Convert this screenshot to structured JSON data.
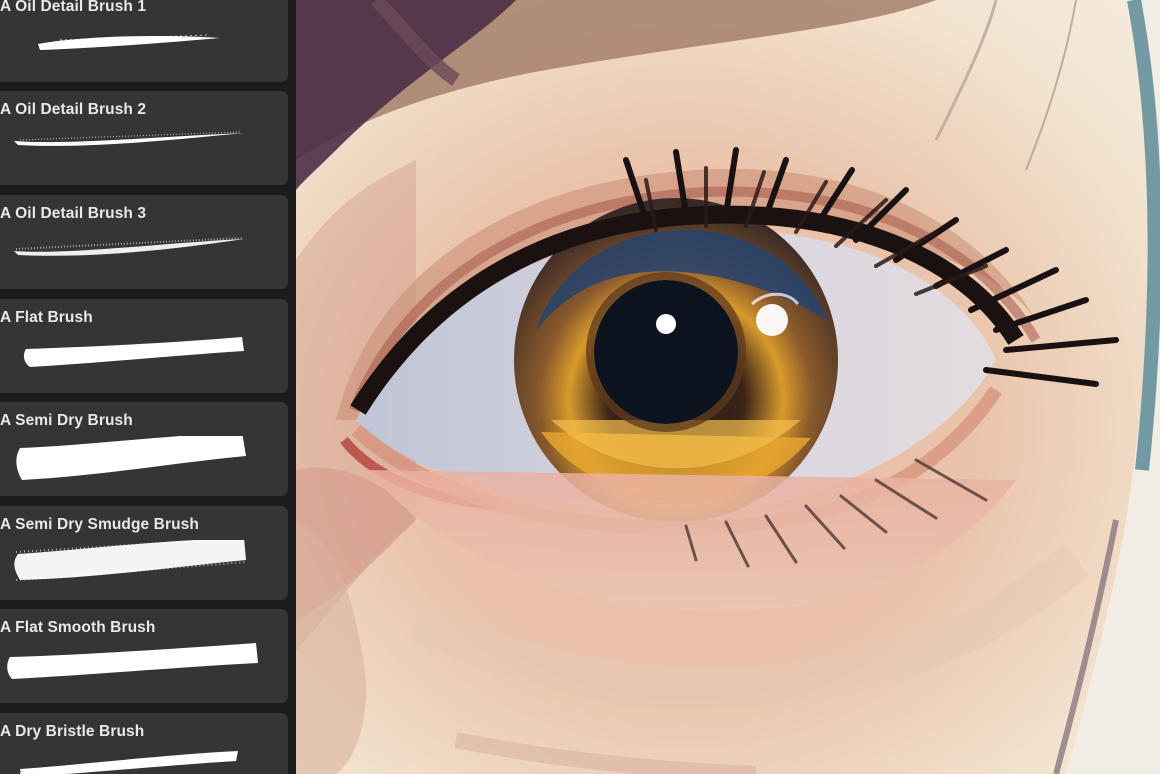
{
  "brushes": [
    {
      "label": "A Oil Detail Brush 1",
      "stroke": "thin-tapered-icon"
    },
    {
      "label": "A Oil Detail Brush 2",
      "stroke": "thin-textured-icon"
    },
    {
      "label": "A Oil Detail Brush 3",
      "stroke": "thin-grainy-icon"
    },
    {
      "label": "A Flat Brush",
      "stroke": "flat-solid-icon"
    },
    {
      "label": "A Semi Dry Brush",
      "stroke": "semi-dry-icon"
    },
    {
      "label": "A Semi Dry Smudge Brush",
      "stroke": "smudge-icon"
    },
    {
      "label": "A Flat Smooth Brush",
      "stroke": "flat-smooth-icon"
    },
    {
      "label": "A Dry Bristle Brush",
      "stroke": "dry-bristle-icon"
    }
  ],
  "canvas": {
    "subject": "painted-eye-artwork"
  },
  "colors": {
    "panel_bg": "#1c1c1c",
    "card_bg": "#353535",
    "label_text": "#e8e8e8",
    "stroke": "#ffffff"
  }
}
